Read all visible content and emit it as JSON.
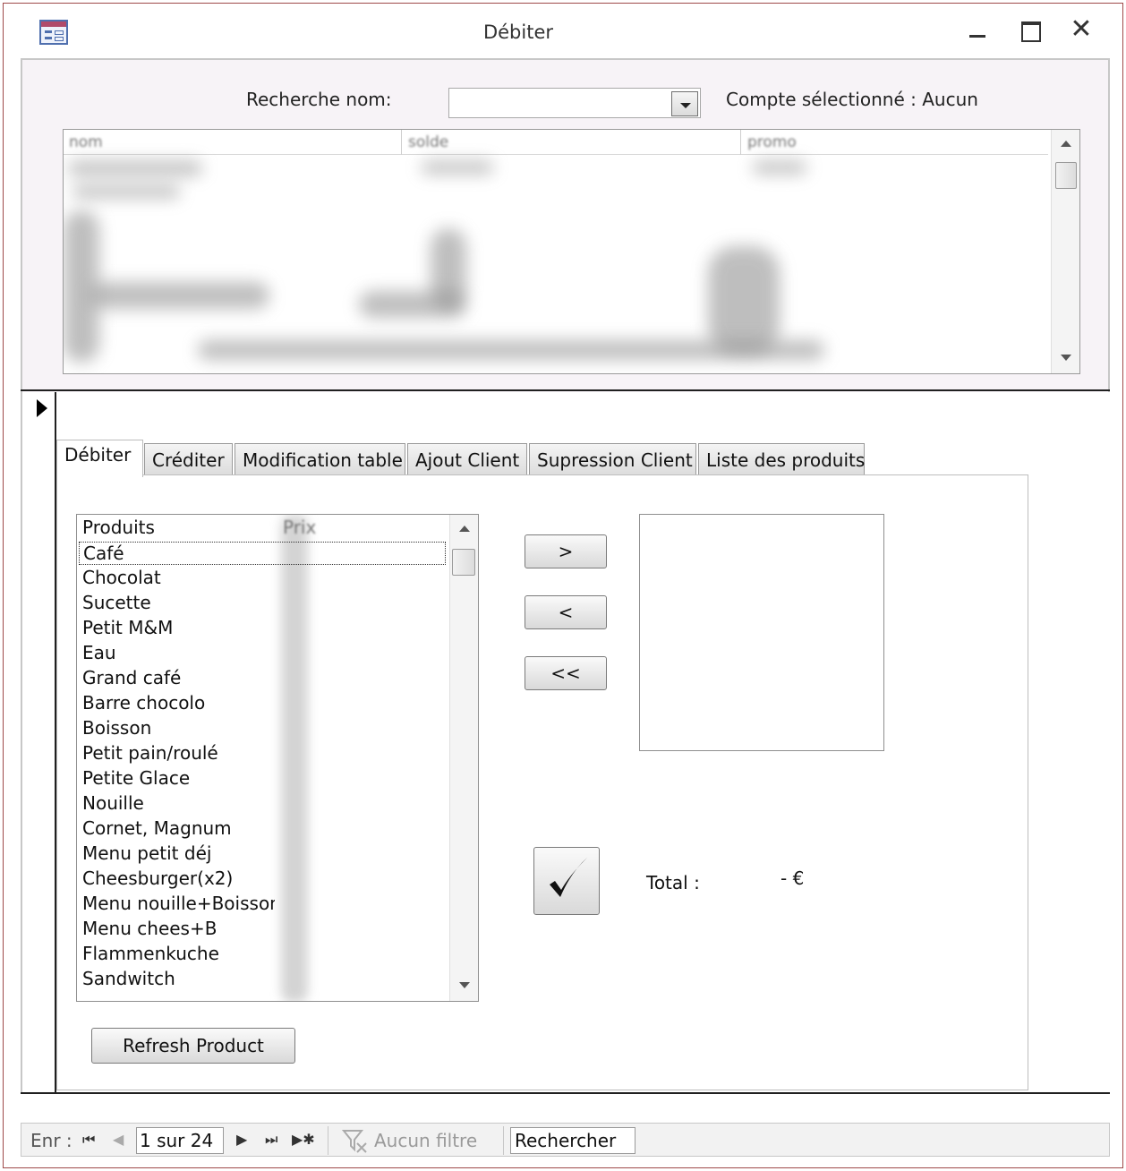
{
  "window": {
    "title": "Débiter"
  },
  "header": {
    "search_label": "Recherche nom:",
    "search_value": "",
    "account_label": "Compte sélectionné : Aucun",
    "grid_columns": [
      "nom",
      "solde",
      "promo"
    ]
  },
  "tabs": [
    {
      "label": "Débiter",
      "active": true
    },
    {
      "label": "Créditer",
      "active": false
    },
    {
      "label": "Modification table",
      "active": false
    },
    {
      "label": "Ajout Client",
      "active": false
    },
    {
      "label": "Supression Client",
      "active": false
    },
    {
      "label": "Liste des produits",
      "active": false
    }
  ],
  "products": {
    "header_name": "Produits",
    "header_price": "Prix",
    "items": [
      "Café",
      "Chocolat",
      "Sucette",
      "Petit M&M",
      "Eau",
      "Grand café",
      "Barre chocolo",
      "Boisson",
      "Petit pain/roulé",
      "Petite Glace",
      "Nouille",
      "Cornet, Magnum",
      "Menu petit déj",
      "Cheesburger(x2)",
      "Menu nouille+Boisson",
      "Menu chees+B",
      "Flammenkuche",
      "Sandwitch"
    ],
    "selected": "Café"
  },
  "buttons": {
    "add": ">",
    "remove": "<",
    "remove_all": "<<",
    "refresh": "Refresh Product"
  },
  "total": {
    "label": "Total :",
    "value": "- €"
  },
  "navigation": {
    "record_label": "Enr :",
    "record_position": "1 sur 24",
    "filter_label": "Aucun filtre",
    "search_placeholder": "Rechercher"
  },
  "colors": {
    "window_border": "#9e4a4a",
    "header_background": "#f7f3f7"
  }
}
